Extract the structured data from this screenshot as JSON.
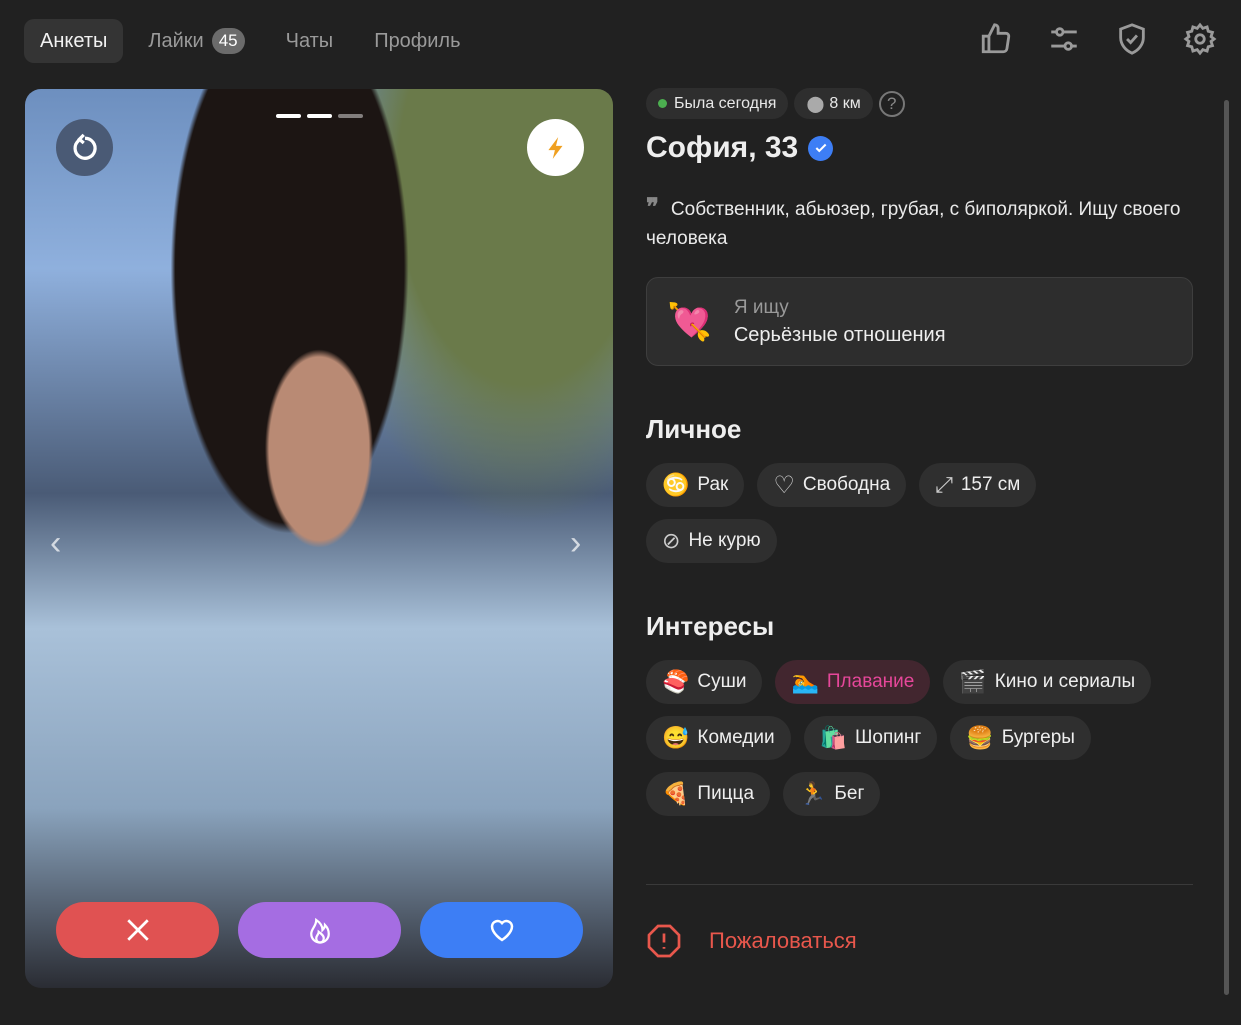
{
  "tabs": [
    {
      "label": "Анкеты",
      "active": true
    },
    {
      "label": "Лайки",
      "badge": "45"
    },
    {
      "label": "Чаты"
    },
    {
      "label": "Профиль"
    }
  ],
  "toolbar_icons": [
    "thumbs-up-icon",
    "sliders-icon",
    "shield-check-icon",
    "gear-icon"
  ],
  "photo": {
    "count": 3,
    "current": 2
  },
  "profile": {
    "status": "Была сегодня",
    "status_color": "#4caf50",
    "distance": "8 км",
    "name": "София, 33",
    "bio": "Собственник, абьюзер, грубая, с биполяркой. Ищу своего человека",
    "seeking_label": "Я ищу",
    "seeking_value": "Серьёзные отношения",
    "seeking_emoji": "💘"
  },
  "personal": {
    "title": "Личное",
    "items": [
      {
        "icon": "zodiac-icon",
        "label": "Рак"
      },
      {
        "icon": "heart-outline-icon",
        "label": "Свободна"
      },
      {
        "icon": "height-icon",
        "label": "157 см"
      },
      {
        "icon": "no-smoking-icon",
        "label": "Не курю"
      }
    ]
  },
  "interests": {
    "title": "Интересы",
    "items": [
      {
        "emoji": "🍣",
        "label": "Суши"
      },
      {
        "emoji": "🏊",
        "label": "Плавание",
        "highlight": true
      },
      {
        "emoji": "🎬",
        "label": "Кино и сериалы"
      },
      {
        "emoji": "😅",
        "label": "Комедии"
      },
      {
        "emoji": "🛍️",
        "label": "Шопинг"
      },
      {
        "emoji": "🍔",
        "label": "Бургеры"
      },
      {
        "emoji": "🍕",
        "label": "Пицца"
      },
      {
        "emoji": "🏃",
        "label": "Бег"
      }
    ]
  },
  "report_label": "Пожаловаться",
  "colors": {
    "dislike": "#e05252",
    "superlike": "#a56de2",
    "like": "#3d7ef5",
    "report": "#e8574c",
    "accent_pink": "#e6479a"
  }
}
